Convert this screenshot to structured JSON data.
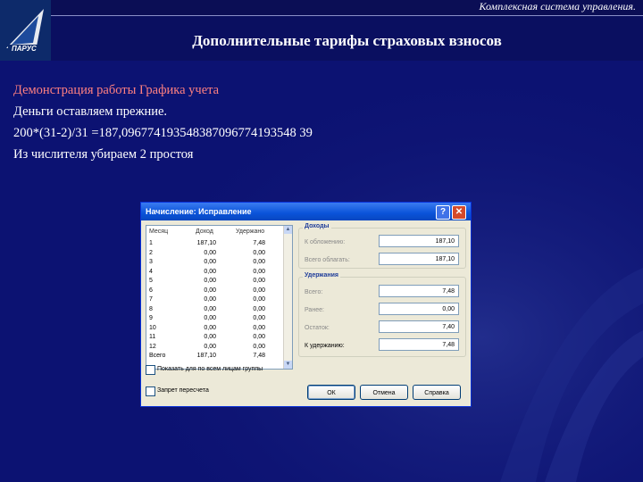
{
  "header": {
    "system_name": "Комплексная система управления.",
    "slide_title": "Дополнительные тарифы страховых взносов"
  },
  "body": {
    "line1": "Демонстрация работы Графика учета",
    "line2": "Деньги оставляем прежние.",
    "line3": "200*(31-2)/31 =187,096774193548387096774193548 39",
    "line4": "Из числителя убираем 2 простоя"
  },
  "dialog": {
    "title": "Начисление: Исправление",
    "help_btn": "?",
    "close_btn": "✕",
    "table": {
      "headers": [
        "Месяц",
        "Доход",
        "Удержано"
      ],
      "rows": [
        [
          "1",
          "187,10",
          "7,48"
        ],
        [
          "2",
          "0,00",
          "0,00"
        ],
        [
          "3",
          "0,00",
          "0,00"
        ],
        [
          "4",
          "0,00",
          "0,00"
        ],
        [
          "5",
          "0,00",
          "0,00"
        ],
        [
          "6",
          "0,00",
          "0,00"
        ],
        [
          "7",
          "0,00",
          "0,00"
        ],
        [
          "8",
          "0,00",
          "0,00"
        ],
        [
          "9",
          "0,00",
          "0,00"
        ],
        [
          "10",
          "0,00",
          "0,00"
        ],
        [
          "11",
          "0,00",
          "0,00"
        ],
        [
          "12",
          "0,00",
          "0,00"
        ],
        [
          "Всего",
          "187,10",
          "7,48"
        ]
      ]
    },
    "income": {
      "title": "Доходы",
      "taxable_label": "К обложению:",
      "taxable_value": "187,10",
      "total_label": "Всего облагать:",
      "total_value": "187,10"
    },
    "deductions": {
      "title": "Удержания",
      "total_label": "Всего:",
      "total_value": "7,48",
      "earlier_label": "Ранее:",
      "earlier_value": "0,00",
      "balance_label": "Остаток:",
      "balance_value": "7,40",
      "to_withhold_label": "К удержанию:",
      "to_withhold_value": "7,48"
    },
    "checkbox1_label": "Показать для по всем лицам группы",
    "checkbox2_label": "Запрет пересчета",
    "ok_btn": "ОК",
    "cancel_btn": "Отмена",
    "help_button": "Справка"
  },
  "colors": {
    "background": "#0c1272",
    "link": "#ff8080",
    "dialog_title": "#0a53d9"
  }
}
